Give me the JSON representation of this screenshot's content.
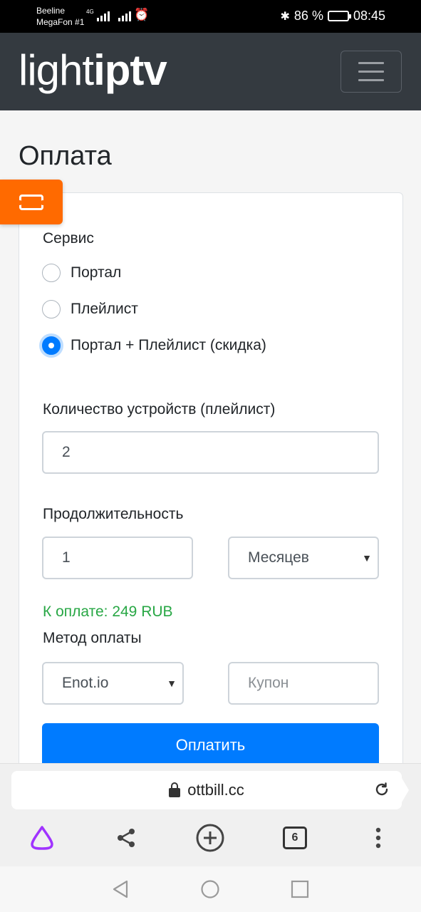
{
  "status_bar": {
    "carrier1": "Beeline",
    "carrier2": "MegaFon #1",
    "network_tag": "4G",
    "battery_percent": "86 %",
    "battery_level": 0.86,
    "time": "08:45"
  },
  "navbar": {
    "logo_light": "light",
    "logo_bold": "iptv",
    "menu_icon": "hamburger-icon"
  },
  "page": {
    "title": "Оплата",
    "coupon_tab_icon": "ticket-icon"
  },
  "form": {
    "service_label": "Сервис",
    "service_options": [
      {
        "label": "Портал",
        "checked": false
      },
      {
        "label": "Плейлист",
        "checked": false
      },
      {
        "label": "Портал + Плейлист (скидка)",
        "checked": true
      }
    ],
    "devices_label": "Количество устройств (плейлист)",
    "devices_value": "2",
    "duration_label": "Продолжительность",
    "duration_value": "1",
    "duration_unit": "Месяцев",
    "total_text": "К оплате: 249 RUB",
    "method_label": "Метод оплаты",
    "method_value": "Enot.io",
    "coupon_placeholder": "Купон",
    "pay_button": "Оплатить"
  },
  "browser": {
    "url": "ottbill.cc",
    "tabs_count": "6",
    "icons": [
      "alice-icon",
      "share-icon",
      "new-tab-icon",
      "tabs-icon",
      "more-icon",
      "reload-icon",
      "lock-icon"
    ]
  },
  "colors": {
    "navbar": "#343a40",
    "primary": "#007bff",
    "success": "#28a745",
    "coupon_tab": "#ff6a00",
    "alice": "#a033ff"
  }
}
